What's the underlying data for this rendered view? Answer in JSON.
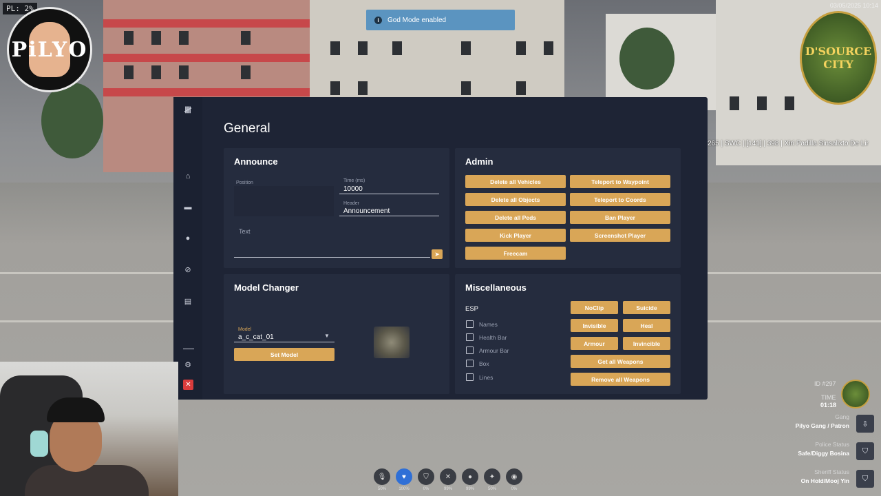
{
  "hud": {
    "pl_text": "PL: 2%",
    "date_text": "03/05/2025 10:14",
    "nametag": "265 | SWC | [141] | 398 | Xiri Padilla Sinsalixto De Lir",
    "toast": {
      "message": "God Mode enabled",
      "icon": "info-icon"
    },
    "logo_left_text": "PiLYO",
    "logo_right_text": "D'SOURCE CITY"
  },
  "menu": {
    "title": "General",
    "sidebar": {
      "icons": [
        "tally-icon",
        "home-icon",
        "car-icon",
        "person-icon",
        "ban-icon",
        "document-icon",
        "gear-icon",
        "close-icon"
      ]
    },
    "announce": {
      "title": "Announce",
      "position_label": "Position",
      "time_label": "Time (ms)",
      "time_value": "10000",
      "header_label": "Header",
      "header_value": "Announcement",
      "text_label": "Text",
      "send_icon": "send-icon"
    },
    "admin": {
      "title": "Admin",
      "buttons": [
        "Delete all Vehicles",
        "Teleport to Waypoint",
        "Delete all Objects",
        "Teleport to Coords",
        "Delete all Peds",
        "Ban Player",
        "Kick Player",
        "Screenshot Player",
        "Freecam"
      ]
    },
    "model_changer": {
      "title": "Model Changer",
      "model_label": "Model",
      "model_value": "a_c_cat_01",
      "set_button": "Set Model"
    },
    "misc": {
      "title": "Miscellaneous",
      "esp_label": "ESP",
      "esp_options": [
        "Names",
        "Health Bar",
        "Armour Bar",
        "Box",
        "Lines"
      ],
      "buttons": [
        "NoClip",
        "Suicide",
        "Invisible",
        "Heal",
        "Armour",
        "Invincible",
        "Get all Weapons",
        "Remove all Weapons"
      ]
    }
  },
  "right_hud": {
    "id": "ID #297",
    "time_label": "TIME",
    "time_value": "01:18",
    "rows": [
      {
        "label": "Gang",
        "value": "Pilyo Gang / Patron"
      },
      {
        "label": "Police Status",
        "value": "Safe/Diggy Bosina"
      },
      {
        "label": "Sheriff Status",
        "value": "On Hold/Mooj Yin"
      }
    ]
  },
  "status_bar": [
    {
      "icon": "mic-icon",
      "value": "50%"
    },
    {
      "icon": "heart-icon",
      "value": "100%"
    },
    {
      "icon": "shield-icon",
      "value": "0%"
    },
    {
      "icon": "hunger-icon",
      "value": "99%"
    },
    {
      "icon": "water-icon",
      "value": "99%"
    },
    {
      "icon": "stamina-icon",
      "value": "50%"
    },
    {
      "icon": "stress-icon",
      "value": "0%"
    }
  ]
}
